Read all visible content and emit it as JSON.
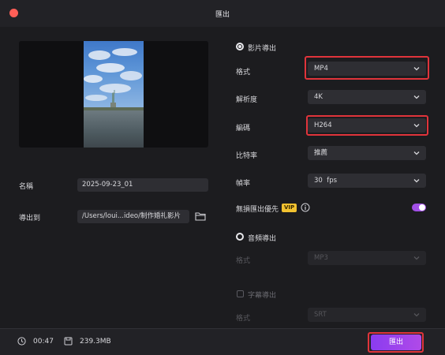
{
  "window": {
    "title": "匯出"
  },
  "left": {
    "name_label": "名稱",
    "name_value": "2025-09-23_01",
    "export_to_label": "導出到",
    "export_path": "/Users/loui...ideo/制作婚礼影片"
  },
  "video_export": {
    "section_label": "影片導出",
    "format_label": "格式",
    "format_value": "MP4",
    "resolution_label": "解析度",
    "resolution_value": "4K",
    "encoder_label": "編碼",
    "encoder_value": "H264",
    "bitrate_label": "比特率",
    "bitrate_value": "推薦",
    "framerate_label": "幀率",
    "framerate_value": "30  fps",
    "lossless_label": "無損匯出優先",
    "vip_badge": "VIP",
    "lossless_enabled": true
  },
  "audio_export": {
    "section_label": "音頻導出",
    "format_label": "格式",
    "format_value": "MP3"
  },
  "subtitle_export": {
    "section_label": "字幕導出",
    "format_label": "格式",
    "format_value": "SRT"
  },
  "footer": {
    "duration": "00:47",
    "size": "239.3MB",
    "export_label": "匯出"
  },
  "colors": {
    "accent": "#a14fe6",
    "highlight": "#e0343b",
    "background": "#1c1c1f"
  }
}
